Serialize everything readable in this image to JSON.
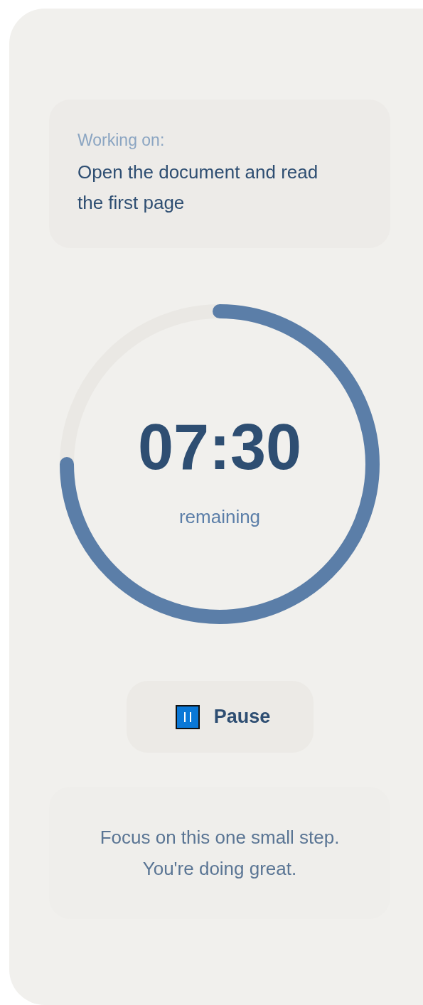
{
  "task": {
    "label": "Working on:",
    "text": "Open the document and read the first page"
  },
  "timer": {
    "time": "07:30",
    "caption": "remaining",
    "level": 0.75
  },
  "pause_button": {
    "label": "Pause"
  },
  "encouragement": {
    "lines": [
      "Focus on this one small step.",
      "You're doing great."
    ]
  }
}
